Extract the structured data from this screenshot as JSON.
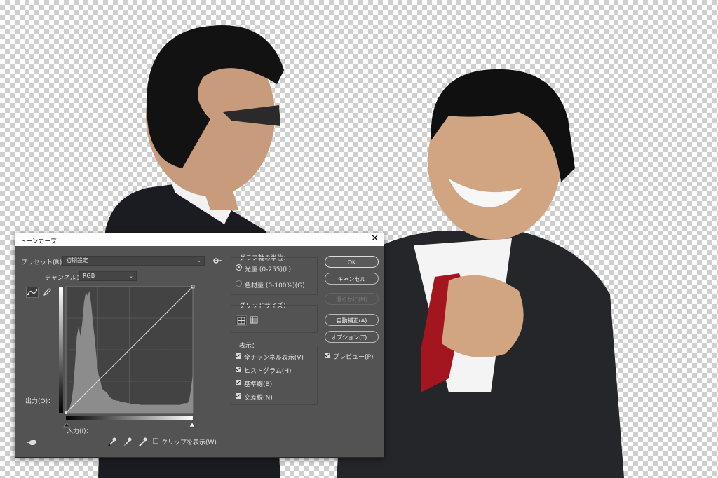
{
  "dialog": {
    "title": "トーンカーブ",
    "close_glyph": "✕",
    "preset_label": "プリセット(R)：",
    "preset_value": "初期設定",
    "channel_label": "チャンネル：",
    "channel_value": "RGB",
    "output_label": "出力(O)：",
    "input_label": "入力(I)：",
    "clip_label": "クリップを表示(W)",
    "clip_checked": false,
    "graph_units": {
      "title": "グラフ軸の単位：",
      "options": [
        {
          "label": "光量 (0-255)(L)",
          "selected": true
        },
        {
          "label": "色材量 (0-100%)(G)",
          "selected": false
        }
      ]
    },
    "grid_size": {
      "title": "グリッドサイズ："
    },
    "display": {
      "title": "表示：",
      "options": [
        {
          "label": "全チャンネル表示(V)",
          "checked": true
        },
        {
          "label": "ヒストグラム(H)",
          "checked": true
        },
        {
          "label": "基準線(B)",
          "checked": true
        },
        {
          "label": "交差線(N)",
          "checked": true
        }
      ]
    },
    "buttons": {
      "ok": "OK",
      "cancel": "キャンセル",
      "smooth": "滑らかに(M)",
      "auto": "自動補正(A)",
      "options": "オプション(T)..."
    },
    "preview_label": "プレビュー(P)",
    "preview_checked": true,
    "icons": {
      "curve_tool": "curve-point-icon",
      "pencil_tool": "pencil-icon",
      "gear": "gear-icon",
      "target_adjust": "hand-adjust-icon",
      "eyedropper_black": "eyedropper-black-icon",
      "eyedropper_gray": "eyedropper-gray-icon",
      "eyedropper_white": "eyedropper-white-icon",
      "grid_coarse": "grid-4x4-icon",
      "grid_fine": "grid-10x10-icon"
    }
  },
  "curve_data": {
    "type": "curve",
    "channel": "RGB",
    "points": [
      [
        0,
        0
      ],
      [
        255,
        255
      ]
    ],
    "histogram": [
      0,
      2,
      6,
      14,
      30,
      60,
      95,
      108,
      96,
      112,
      138,
      150,
      146,
      152,
      134,
      110,
      90,
      65,
      48,
      40,
      30,
      28,
      26,
      24,
      20,
      18,
      17,
      16,
      15,
      15,
      14,
      13,
      13,
      13,
      12,
      12,
      11,
      11,
      11,
      11,
      11,
      10,
      10,
      10,
      10,
      10,
      10,
      10,
      10,
      10,
      10,
      10,
      10,
      10,
      10,
      10,
      10,
      10,
      10,
      10,
      10,
      10,
      10,
      10,
      11,
      12,
      12,
      12,
      16,
      30,
      48
    ]
  }
}
